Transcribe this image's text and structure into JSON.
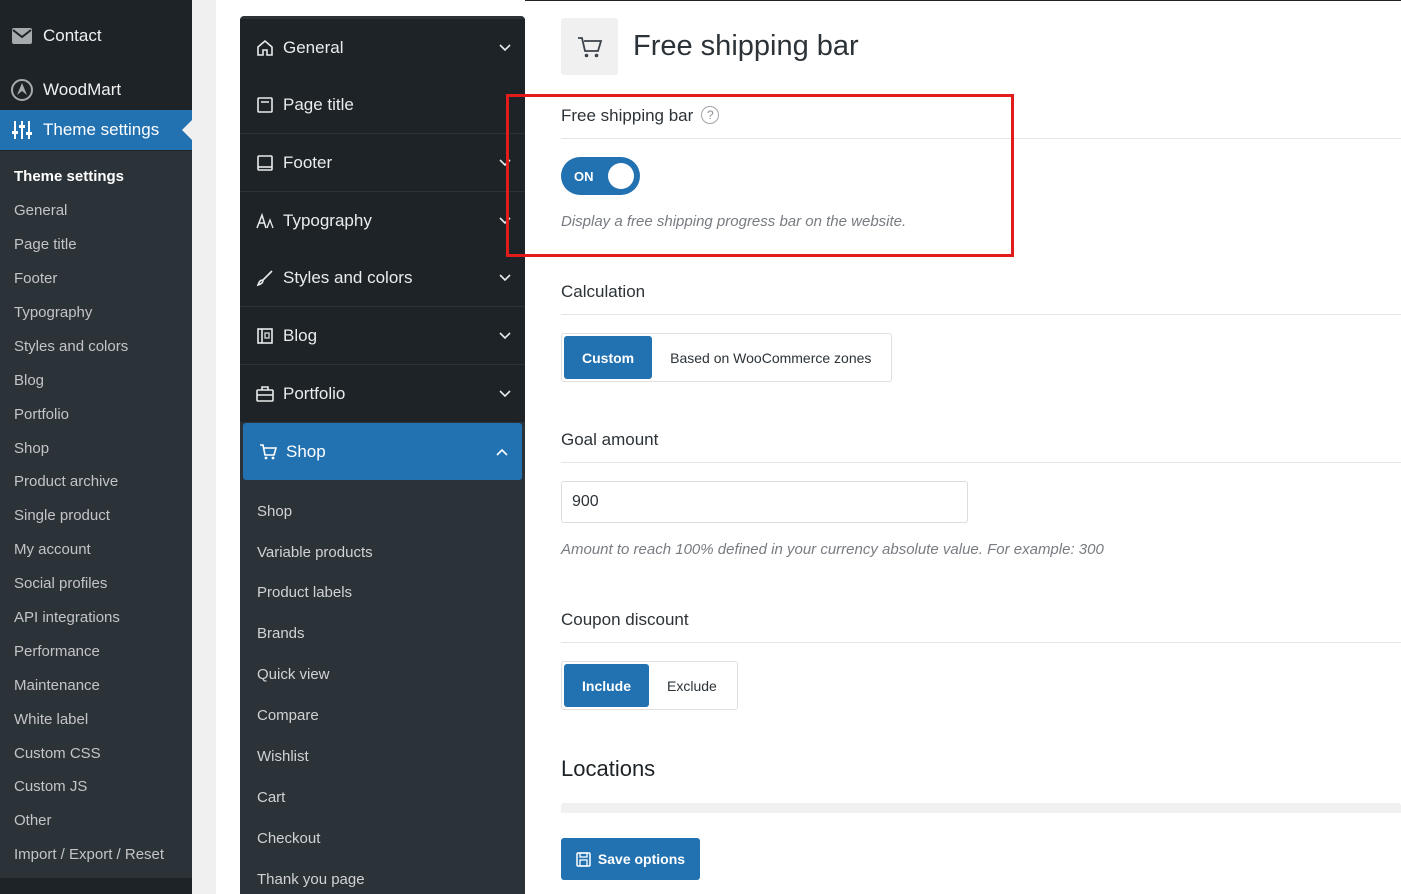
{
  "wp_menu": {
    "top_items": [
      {
        "label": "Contact",
        "icon": "envelope-icon"
      },
      {
        "label": "WoodMart",
        "icon": "woodmart-logo-icon"
      },
      {
        "label": "Theme settings",
        "icon": "sliders-icon"
      }
    ],
    "submenu": [
      "Theme settings",
      "General",
      "Page title",
      "Footer",
      "Typography",
      "Styles and colors",
      "Blog",
      "Portfolio",
      "Shop",
      "Product archive",
      "Single product",
      "My account",
      "Social profiles",
      "API integrations",
      "Performance",
      "Maintenance",
      "White label",
      "Custom CSS",
      "Custom JS",
      "Other",
      "Import / Export / Reset"
    ]
  },
  "theme_nav": {
    "items": [
      {
        "label": "General",
        "icon": "home-icon"
      },
      {
        "label": "Page title",
        "icon": "page-title-icon"
      },
      {
        "label": "Footer",
        "icon": "footer-icon"
      },
      {
        "label": "Typography",
        "icon": "typography-icon"
      },
      {
        "label": "Styles and colors",
        "icon": "brush-icon"
      },
      {
        "label": "Blog",
        "icon": "blog-icon"
      },
      {
        "label": "Portfolio",
        "icon": "briefcase-icon"
      },
      {
        "label": "Shop",
        "icon": "cart-icon"
      }
    ],
    "shop_sub": [
      "Shop",
      "Variable products",
      "Product labels",
      "Brands",
      "Quick view",
      "Compare",
      "Wishlist",
      "Cart",
      "Checkout",
      "Thank you page"
    ]
  },
  "main": {
    "title": "Free shipping bar",
    "free_shipping": {
      "label": "Free shipping bar",
      "help": "?",
      "toggle_label": "ON",
      "description": "Display a free shipping progress bar on the website."
    },
    "calculation": {
      "label": "Calculation",
      "options": [
        "Custom",
        "Based on WooCommerce zones"
      ],
      "selected": "Custom"
    },
    "goal": {
      "label": "Goal amount",
      "value": "900",
      "description": "Amount to reach 100% defined in your currency absolute value. For example: 300"
    },
    "coupon": {
      "label": "Coupon discount",
      "options": [
        "Include",
        "Exclude"
      ],
      "selected": "Include"
    },
    "locations": {
      "label": "Locations"
    },
    "save_label": "Save options"
  },
  "colors": {
    "accent": "#2271b1",
    "highlight": "#e21b1b",
    "sidebar": "#1d2327"
  }
}
